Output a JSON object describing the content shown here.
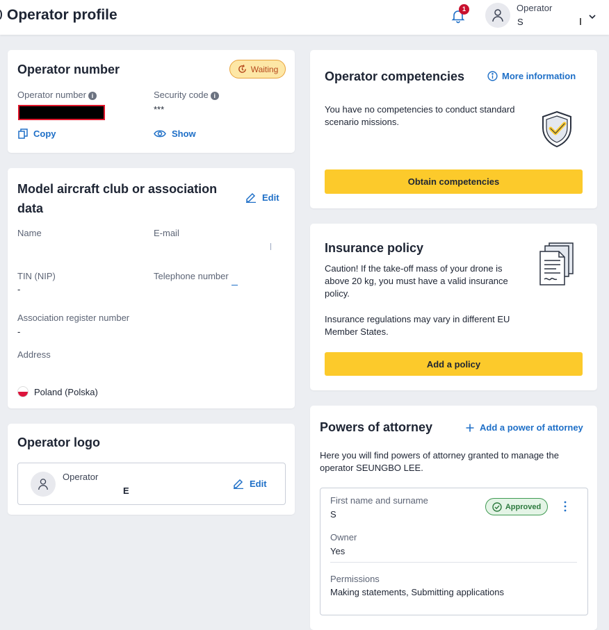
{
  "header": {
    "title": "Operator profile",
    "notification_count": "1",
    "user_role": "Operator",
    "user_name": "S"
  },
  "operator_number_card": {
    "title": "Operator number",
    "status_badge": "Waiting",
    "operator_number_label": "Operator number",
    "security_code_label": "Security code",
    "security_code_value": "***",
    "copy_label": "Copy",
    "show_label": "Show",
    "colors": {
      "redaction": "#000000",
      "redaction_border": "#e0162b"
    }
  },
  "club_card": {
    "title": "Model aircraft club or association data",
    "edit_label": "Edit",
    "name_label": "Name",
    "email_label": "E-mail",
    "tin_label": "TIN (NIP)",
    "tin_value": "-",
    "phone_label": "Telephone number",
    "register_label": "Association register number",
    "register_value": "-",
    "address_label": "Address",
    "country": "Poland (Polska)"
  },
  "logo_card": {
    "title": "Operator logo",
    "owner_role": "Operator",
    "owner_initial": "E",
    "edit_label": "Edit"
  },
  "competencies_card": {
    "title": "Operator competencies",
    "more_info_label": "More information",
    "message": "You have no competencies to conduct standard scenario missions.",
    "button_label": "Obtain competencies"
  },
  "insurance_card": {
    "title": "Insurance policy",
    "caution": "Caution! If the take-off mass of your drone is above 20 kg, you must have a valid insurance policy.",
    "note": "Insurance regulations may vary in different EU Member States.",
    "button_label": "Add a policy"
  },
  "attorney_card": {
    "title": "Powers of attorney",
    "add_label": "Add a power of attorney",
    "description": "Here you will find powers of attorney granted to manage the operator SEUNGBO LEE.",
    "entry": {
      "name_label": "First name and surname",
      "name_value": "S",
      "status": "Approved",
      "owner_label": "Owner",
      "owner_value": "Yes",
      "permissions_label": "Permissions",
      "permissions_value": "Making statements, Submitting applications"
    }
  },
  "colors": {
    "accent_blue": "#1e6fc7",
    "button_yellow": "#fcca2b",
    "waiting_bg": "#fde7a6",
    "waiting_text": "#b4471b",
    "approved_bg": "#e4f4e6",
    "approved_text": "#2d7a3e"
  }
}
